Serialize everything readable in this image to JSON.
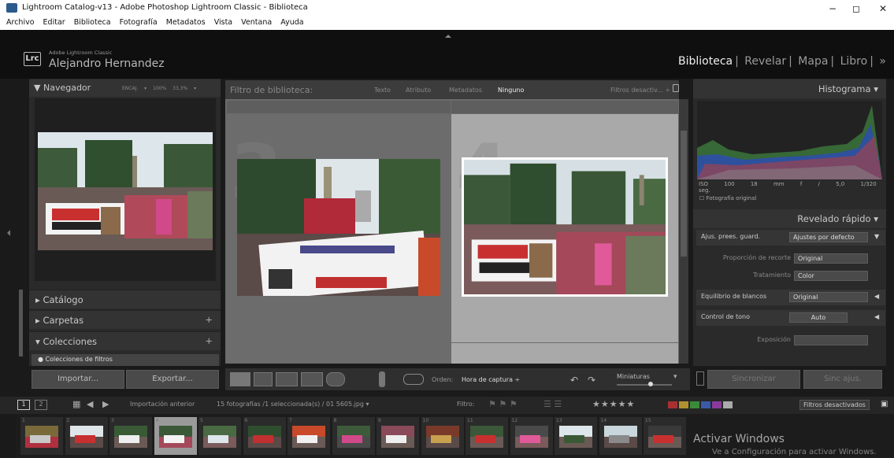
{
  "window": {
    "title": "Lightroom Catalog-v13 - Adobe Photoshop Lightroom Classic - Biblioteca",
    "minimize": "−",
    "maximize": "◻",
    "close": "✕"
  },
  "menu": [
    "Archivo",
    "Editar",
    "Biblioteca",
    "Fotografía",
    "Metadatos",
    "Vista",
    "Ventana",
    "Ayuda"
  ],
  "identity": {
    "badge": "Lrc",
    "product": "Adobe Lightroom Classic",
    "user": "Alejandro Hernandez",
    "modules": [
      "Biblioteca",
      "Revelar",
      "Mapa",
      "Libro"
    ],
    "modules_more": "»"
  },
  "navigator": {
    "title": "Navegador",
    "zoom_options": "ENCAJ. ▾  100%  33,3% ▾"
  },
  "left_sections": {
    "catalog": "Catálogo",
    "folders": "Carpetas",
    "collections": "Colecciones",
    "collection_filter": "Colecciones de filtros",
    "plus": "+"
  },
  "buttons": {
    "import": "Importar...",
    "export": "Exportar..."
  },
  "filter_bar": {
    "title": "Filtro de biblioteca:",
    "tabs": [
      "Texto",
      "Atributo",
      "Metadatos",
      "Ninguno"
    ],
    "preset": "Filtros desactiv... ÷"
  },
  "grid": {
    "cells": [
      {
        "number": "3"
      },
      {
        "number": "4"
      }
    ]
  },
  "toolbar": {
    "sort_label": "Orden:",
    "sort_value": "Hora de captura ÷",
    "thumbnails_label": "Miniaturas"
  },
  "histogram": {
    "title": "Histograma",
    "info": [
      "ISO 100",
      "18 mm",
      "f / 5,0",
      "1/320 seg."
    ],
    "original_photo": "Fotografía original"
  },
  "quick_develop": {
    "title": "Revelado rápido",
    "rows": [
      {
        "label": "Ajus. prees. guard.",
        "value": "Ajustes por defecto"
      },
      {
        "label": "Proporción de recorte",
        "value": "Original"
      },
      {
        "label": "Tratamiento",
        "value": "Color"
      },
      {
        "label": "Equilibrio de blancos",
        "value": "Original"
      },
      {
        "label": "Control de tono",
        "value": "Auto"
      },
      {
        "label": "Exposición",
        "value": ""
      }
    ]
  },
  "right_buttons": {
    "sync": "Sincronizar",
    "sync_settings": "Sinc ajus."
  },
  "filmstrip_bar": {
    "pages": [
      "1",
      "2"
    ],
    "source": "Importación anterior",
    "count": "15 fotografías /1 seleccionada(s) / 01 5605.jpg ▾",
    "filter_label": "Filtro:",
    "stars": "★★★★★",
    "filters_off": "Filtros desactivados"
  },
  "filmstrip": {
    "numbers": [
      "1",
      "2",
      "3",
      "4",
      "5",
      "6",
      "7",
      "8",
      "9",
      "10",
      "11",
      "12",
      "13",
      "14",
      "15"
    ],
    "selected_index": 4
  },
  "watermark": {
    "line1": "Activar Windows",
    "line2": "Ve a Configuración para activar Windows."
  },
  "colors": {
    "panel_bg": "#2a2a2a",
    "grid_bg": "#6b6b6b",
    "selected_cell": "#a9a9a9",
    "accent_text": "#eeeeee"
  }
}
